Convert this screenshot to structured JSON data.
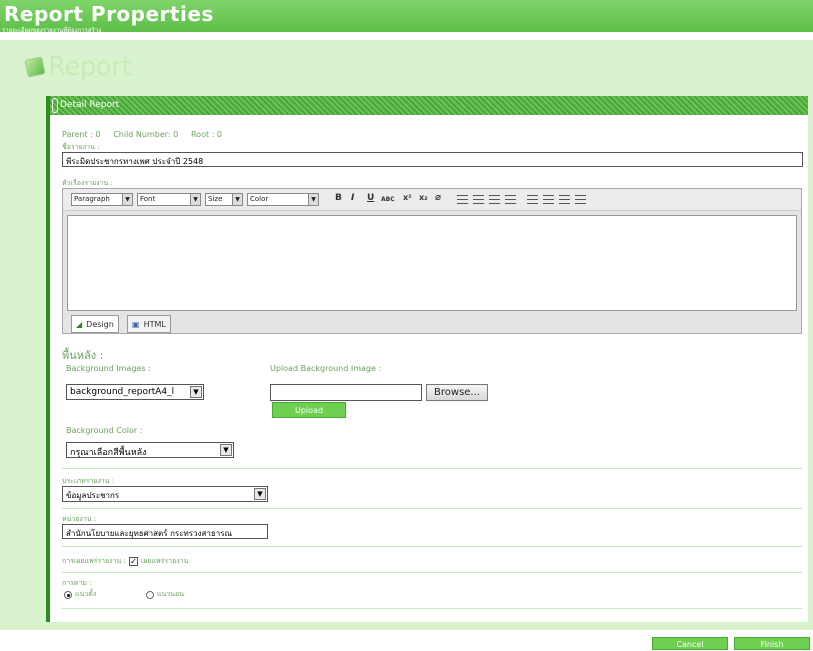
{
  "window": {
    "title": "Report Properties",
    "subtitle": "รายละเอียดของรายงานที่ต้องการสร้าง"
  },
  "brand": {
    "label": "Report"
  },
  "card": {
    "header": "Detail Report",
    "meta": {
      "parent": "Parent : 0",
      "child": "Child Number: 0",
      "root": "Root : 0"
    },
    "name_label": "ชื่อรายงาน :",
    "name_value": "พีระมิดประชากรทางเพศ ประจำปี 2548",
    "title_label": "หัวเรื่องรายงาน :"
  },
  "editor": {
    "paragraph": "Paragraph",
    "font": "Font",
    "size": "Size",
    "color": "Color",
    "bold": "B",
    "italic": "I",
    "underline": "U",
    "strike": "ABC",
    "sup": "x²",
    "sub": "x₂",
    "design_tab": "Design",
    "html_tab": "HTML"
  },
  "background": {
    "heading": "พื้นหลัง :",
    "images_label": "Background Images :",
    "images_value": "background_reportA4_l",
    "upload_label": "Upload Background Image :",
    "upload_value": "",
    "browse": "Browse...",
    "upload": "Upload",
    "color_label": "Background Color :",
    "color_value": "กรุณาเลือกสีพื้นหลัง"
  },
  "type": {
    "label": "ประเภทรายงาน :",
    "value": "ข้อมูลประชากร"
  },
  "agency": {
    "label": "หน่วยงาน :",
    "value": "สำนักนโยบายและยุทธศาสตร์ กระทรวงสาธารณ"
  },
  "publish": {
    "label": "การเผยแพร่รายงาน :",
    "checkbox_label": "เผยแพร่รายงาน",
    "checked": true
  },
  "orientation": {
    "label": "การตาม :",
    "portrait": "แนวตั้ง",
    "landscape": "แนวนอน",
    "selected": "portrait"
  },
  "footer": {
    "cancel": "Cancel",
    "finish": "Finish"
  },
  "colors": {
    "accent": "#5fbf4a",
    "dark": "#2e8b22",
    "panel": "#d9f3cf"
  }
}
